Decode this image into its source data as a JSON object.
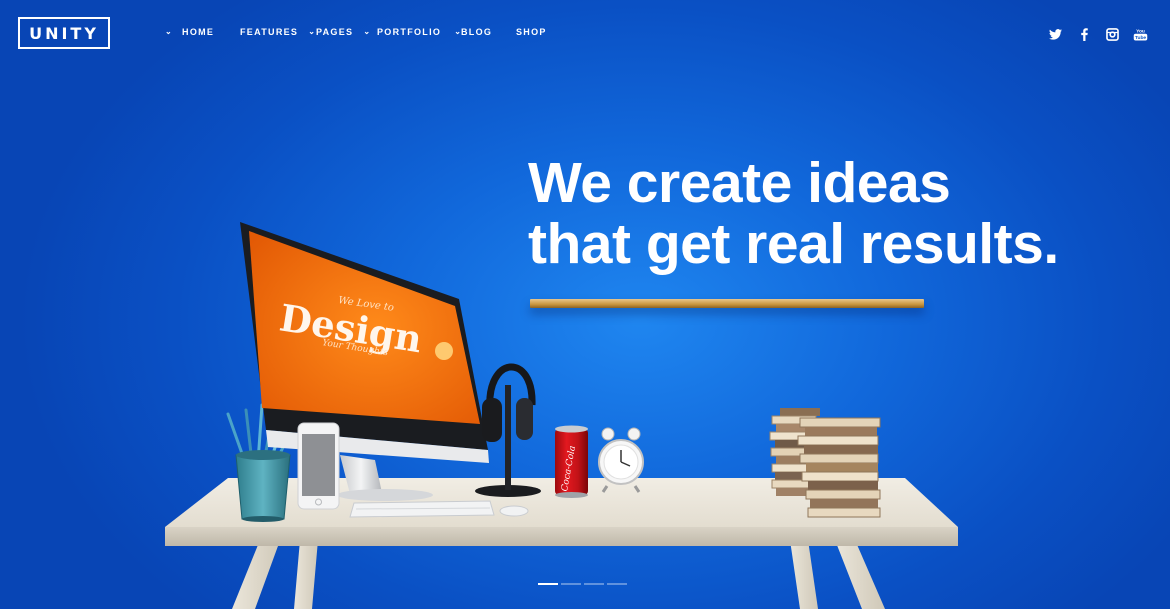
{
  "brand": {
    "logo_text": "UNITY"
  },
  "nav": {
    "items": [
      {
        "label": "HOME",
        "has_dropdown": true
      },
      {
        "label": "FEATURES",
        "has_dropdown": true
      },
      {
        "label": "PAGES",
        "has_dropdown": true
      },
      {
        "label": "PORTFOLIO",
        "has_dropdown": true
      },
      {
        "label": "BLOG",
        "has_dropdown": false
      },
      {
        "label": "SHOP",
        "has_dropdown": false
      }
    ]
  },
  "social": [
    {
      "icon": "twitter-icon"
    },
    {
      "icon": "facebook-icon"
    },
    {
      "icon": "instagram-icon"
    },
    {
      "icon": "youtube-icon",
      "text": "You Tube"
    }
  ],
  "hero": {
    "headline_line1": "We create ideas",
    "headline_line2": "that get real results.",
    "screen_small_top": "We Love to",
    "screen_big": "Design",
    "screen_small_bottom": "Your Thoughts",
    "can_text": "Coca-Cola"
  },
  "slider": {
    "count": 4,
    "active_index": 0
  },
  "colors": {
    "background": "#1168db",
    "accent_orange": "#f06b0c",
    "text": "#ffffff"
  }
}
